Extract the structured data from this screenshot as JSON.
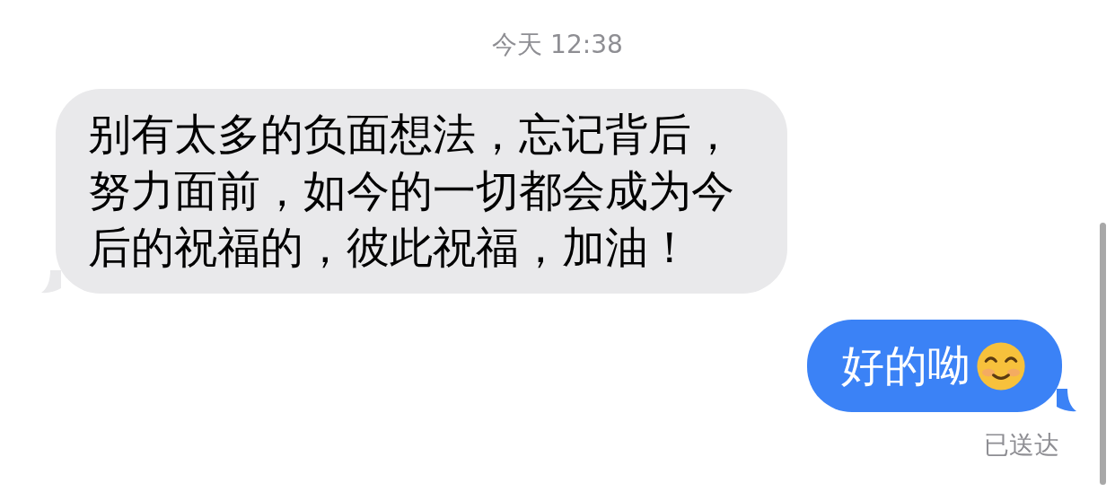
{
  "timestamp": "今天 12:38",
  "messages": [
    {
      "kind": "incoming",
      "text": "别有太多的负面想法，忘记背后，努力面前，如今的一切都会成为今后的祝福的，彼此祝福，加油！"
    },
    {
      "kind": "outgoing",
      "text": "好的呦"
    }
  ],
  "delivery_status": "已送达"
}
